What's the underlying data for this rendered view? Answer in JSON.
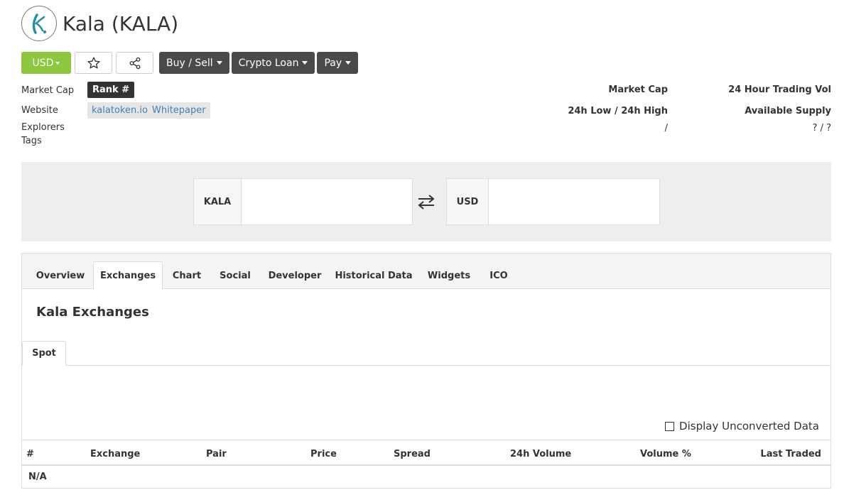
{
  "coin": {
    "title": "Kala (KALA)",
    "logo_icon": "kala-logo-icon"
  },
  "toolbar": {
    "currency_label": "USD",
    "favorite_icon": "star-icon",
    "share_icon": "share-icon",
    "buy_sell_label": "Buy / Sell",
    "crypto_loan_label": "Crypto Loan",
    "pay_label": "Pay"
  },
  "info": {
    "market_cap_label": "Market Cap",
    "rank_label": "Rank #",
    "website_label": "Website",
    "website_link": "kalatoken.io",
    "whitepaper_link": "Whitepaper",
    "explorers_label": "Explorers",
    "tags_label": "Tags"
  },
  "stats": {
    "market_cap_label": "Market Cap",
    "trading_vol_label": "24 Hour Trading Vol",
    "low_high_label": "24h Low / 24h High",
    "low_high_value": "/",
    "supply_label": "Available Supply",
    "supply_value": "? / ?"
  },
  "converter": {
    "from_label": "KALA",
    "from_value": "",
    "to_label": "USD",
    "to_value": "",
    "swap_icon": "swap-arrows-icon"
  },
  "tabs": [
    {
      "label": "Overview",
      "active": false
    },
    {
      "label": "Exchanges",
      "active": true
    },
    {
      "label": "Chart",
      "active": false
    },
    {
      "label": "Social",
      "active": false
    },
    {
      "label": "Developer",
      "active": false
    },
    {
      "label": "Historical Data",
      "active": false
    },
    {
      "label": "Widgets",
      "active": false
    },
    {
      "label": "ICO",
      "active": false
    }
  ],
  "exchanges": {
    "title": "Kala Exchanges",
    "subtab_label": "Spot",
    "checkbox_label": "Display Unconverted Data",
    "columns": [
      "#",
      "Exchange",
      "Pair",
      "Price",
      "Spread",
      "24h Volume",
      "Volume %",
      "Last Traded"
    ],
    "empty_row": "N/A"
  },
  "colors": {
    "accent_green": "#8dc63f",
    "dark_button": "#4a4a4a",
    "link_blue": "#3f7fb5",
    "logo_teal": "#2a8fa6"
  }
}
